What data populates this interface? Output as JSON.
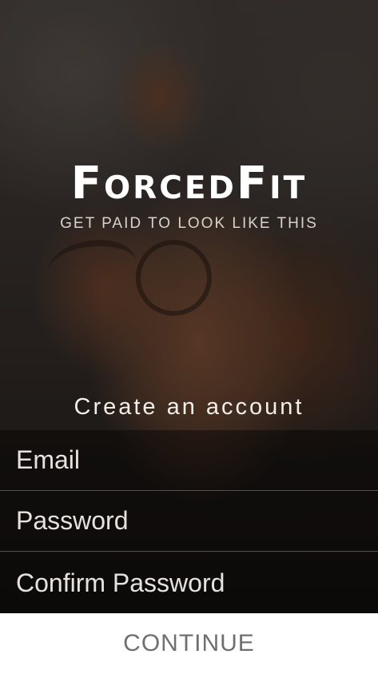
{
  "brand": {
    "logo": "ForcedFit",
    "tagline": "GET PAID TO LOOK LIKE THIS"
  },
  "form": {
    "heading": "Create an account",
    "email_placeholder": "Email",
    "password_placeholder": "Password",
    "confirm_password_placeholder": "Confirm Password",
    "continue_label": "CONTINUE"
  }
}
